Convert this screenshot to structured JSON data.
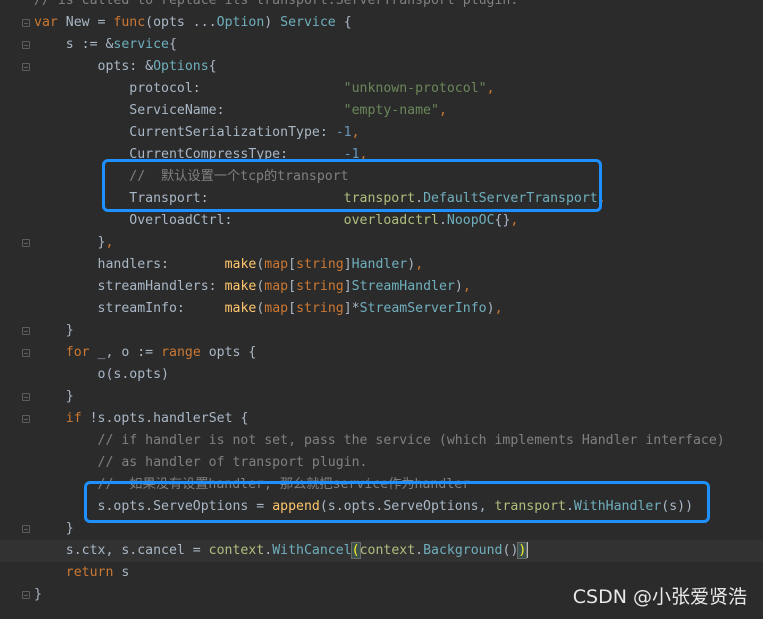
{
  "watermark": "CSDN @小张爱贤浩",
  "colors": {
    "background": "#2b2b2b",
    "keyword": "#cc7832",
    "type": "#6fafbd",
    "function": "#ffc66d",
    "string": "#6a8759",
    "number": "#6897bb",
    "comment": "#808080",
    "highlight_box": "#1e90ff"
  },
  "lines": [
    {
      "fold": false,
      "tokens": [
        [
          "cmt",
          "// is called to replace its transport.ServerTransport plugin."
        ]
      ]
    },
    {
      "fold": true,
      "tokens": [
        [
          "kw",
          "var"
        ],
        [
          "plain",
          " New = "
        ],
        [
          "kw",
          "func"
        ],
        [
          "plain",
          "(opts ..."
        ],
        [
          "type",
          "Option"
        ],
        [
          "plain",
          ") "
        ],
        [
          "type",
          "Service"
        ],
        [
          "plain",
          " {"
        ]
      ]
    },
    {
      "fold": true,
      "tokens": [
        [
          "plain",
          "    s := &"
        ],
        [
          "type",
          "service"
        ],
        [
          "plain",
          "{"
        ]
      ]
    },
    {
      "fold": true,
      "tokens": [
        [
          "plain",
          "        opts: &"
        ],
        [
          "type",
          "Options"
        ],
        [
          "plain",
          "{"
        ]
      ]
    },
    {
      "fold": false,
      "tokens": [
        [
          "plain",
          "            protocol:                  "
        ],
        [
          "str",
          "\"unknown-protocol\""
        ],
        [
          "punct",
          ","
        ]
      ]
    },
    {
      "fold": false,
      "tokens": [
        [
          "plain",
          "            ServiceName:               "
        ],
        [
          "str",
          "\"empty-name\""
        ],
        [
          "punct",
          ","
        ]
      ]
    },
    {
      "fold": false,
      "tokens": [
        [
          "plain",
          "            CurrentSerializationType: "
        ],
        [
          "num",
          "-1"
        ],
        [
          "punct",
          ","
        ]
      ]
    },
    {
      "fold": false,
      "tokens": [
        [
          "plain",
          "            CurrentCompressType:       "
        ],
        [
          "num",
          "-1"
        ],
        [
          "punct",
          ","
        ]
      ]
    },
    {
      "fold": false,
      "tokens": [
        [
          "cmt",
          "            //  默认设置一个tcp的transport"
        ]
      ]
    },
    {
      "fold": false,
      "tokens": [
        [
          "plain",
          "            Transport:                 "
        ],
        [
          "pkg",
          "transport"
        ],
        [
          "plain",
          "."
        ],
        [
          "type",
          "DefaultServerTransport"
        ],
        [
          "punct",
          ","
        ]
      ]
    },
    {
      "fold": false,
      "tokens": [
        [
          "plain",
          "            OverloadCtrl:              "
        ],
        [
          "pkg",
          "overloadctrl"
        ],
        [
          "plain",
          "."
        ],
        [
          "type",
          "NoopOC"
        ],
        [
          "plain",
          "{}"
        ],
        [
          "punct",
          ","
        ]
      ]
    },
    {
      "fold": true,
      "tokens": [
        [
          "plain",
          "        }"
        ],
        [
          "punct",
          ","
        ]
      ]
    },
    {
      "fold": false,
      "tokens": [
        [
          "plain",
          "        handlers:       "
        ],
        [
          "fn",
          "make"
        ],
        [
          "plain",
          "("
        ],
        [
          "kw",
          "map"
        ],
        [
          "plain",
          "["
        ],
        [
          "kw",
          "string"
        ],
        [
          "plain",
          "]"
        ],
        [
          "type",
          "Handler"
        ],
        [
          "plain",
          ")"
        ],
        [
          "punct",
          ","
        ]
      ]
    },
    {
      "fold": false,
      "tokens": [
        [
          "plain",
          "        streamHandlers: "
        ],
        [
          "fn",
          "make"
        ],
        [
          "plain",
          "("
        ],
        [
          "kw",
          "map"
        ],
        [
          "plain",
          "["
        ],
        [
          "kw",
          "string"
        ],
        [
          "plain",
          "]"
        ],
        [
          "type",
          "StreamHandler"
        ],
        [
          "plain",
          ")"
        ],
        [
          "punct",
          ","
        ]
      ]
    },
    {
      "fold": false,
      "tokens": [
        [
          "plain",
          "        streamInfo:     "
        ],
        [
          "fn",
          "make"
        ],
        [
          "plain",
          "("
        ],
        [
          "kw",
          "map"
        ],
        [
          "plain",
          "["
        ],
        [
          "kw",
          "string"
        ],
        [
          "plain",
          "]*"
        ],
        [
          "type",
          "StreamServerInfo"
        ],
        [
          "plain",
          ")"
        ],
        [
          "punct",
          ","
        ]
      ]
    },
    {
      "fold": true,
      "tokens": [
        [
          "plain",
          "    }"
        ]
      ]
    },
    {
      "fold": true,
      "tokens": [
        [
          "plain",
          "    "
        ],
        [
          "kw",
          "for"
        ],
        [
          "plain",
          " _, o := "
        ],
        [
          "kw",
          "range"
        ],
        [
          "plain",
          " opts {"
        ]
      ]
    },
    {
      "fold": false,
      "tokens": [
        [
          "plain",
          "        o(s.opts)"
        ]
      ]
    },
    {
      "fold": true,
      "tokens": [
        [
          "plain",
          "    }"
        ]
      ]
    },
    {
      "fold": true,
      "tokens": [
        [
          "plain",
          "    "
        ],
        [
          "kw",
          "if"
        ],
        [
          "plain",
          " !s.opts.handlerSet {"
        ]
      ]
    },
    {
      "fold": false,
      "tokens": [
        [
          "cmt",
          "        // if handler is not set, pass the service (which implements Handler interface)"
        ]
      ]
    },
    {
      "fold": false,
      "tokens": [
        [
          "cmt",
          "        // as handler of transport plugin."
        ]
      ]
    },
    {
      "fold": false,
      "tokens": [
        [
          "cmt",
          "        //  如果没有设置handler, 那么就把service作为handler"
        ]
      ]
    },
    {
      "fold": false,
      "tokens": [
        [
          "plain",
          "        s.opts.ServeOptions = "
        ],
        [
          "fn",
          "append"
        ],
        [
          "plain",
          "(s.opts.ServeOptions, "
        ],
        [
          "pkg",
          "transport"
        ],
        [
          "plain",
          "."
        ],
        [
          "type",
          "WithHandler"
        ],
        [
          "plain",
          "(s))"
        ]
      ]
    },
    {
      "fold": true,
      "tokens": [
        [
          "plain",
          "    }"
        ]
      ]
    },
    {
      "fold": false,
      "current": true,
      "tokens": [
        [
          "plain",
          "    s.ctx, s.cancel = "
        ],
        [
          "pkg",
          "context"
        ],
        [
          "plain",
          "."
        ],
        [
          "type",
          "WithCancel"
        ],
        [
          "hl",
          "("
        ],
        [
          "pkg",
          "context"
        ],
        [
          "plain",
          "."
        ],
        [
          "type",
          "Background"
        ],
        [
          "plain",
          "()"
        ],
        [
          "hl",
          ")"
        ],
        [
          "caret",
          ""
        ]
      ]
    },
    {
      "fold": false,
      "tokens": [
        [
          "plain",
          "    "
        ],
        [
          "kw",
          "return"
        ],
        [
          "plain",
          " s"
        ]
      ]
    },
    {
      "fold": true,
      "tokens": [
        [
          "plain",
          "}"
        ]
      ]
    }
  ]
}
